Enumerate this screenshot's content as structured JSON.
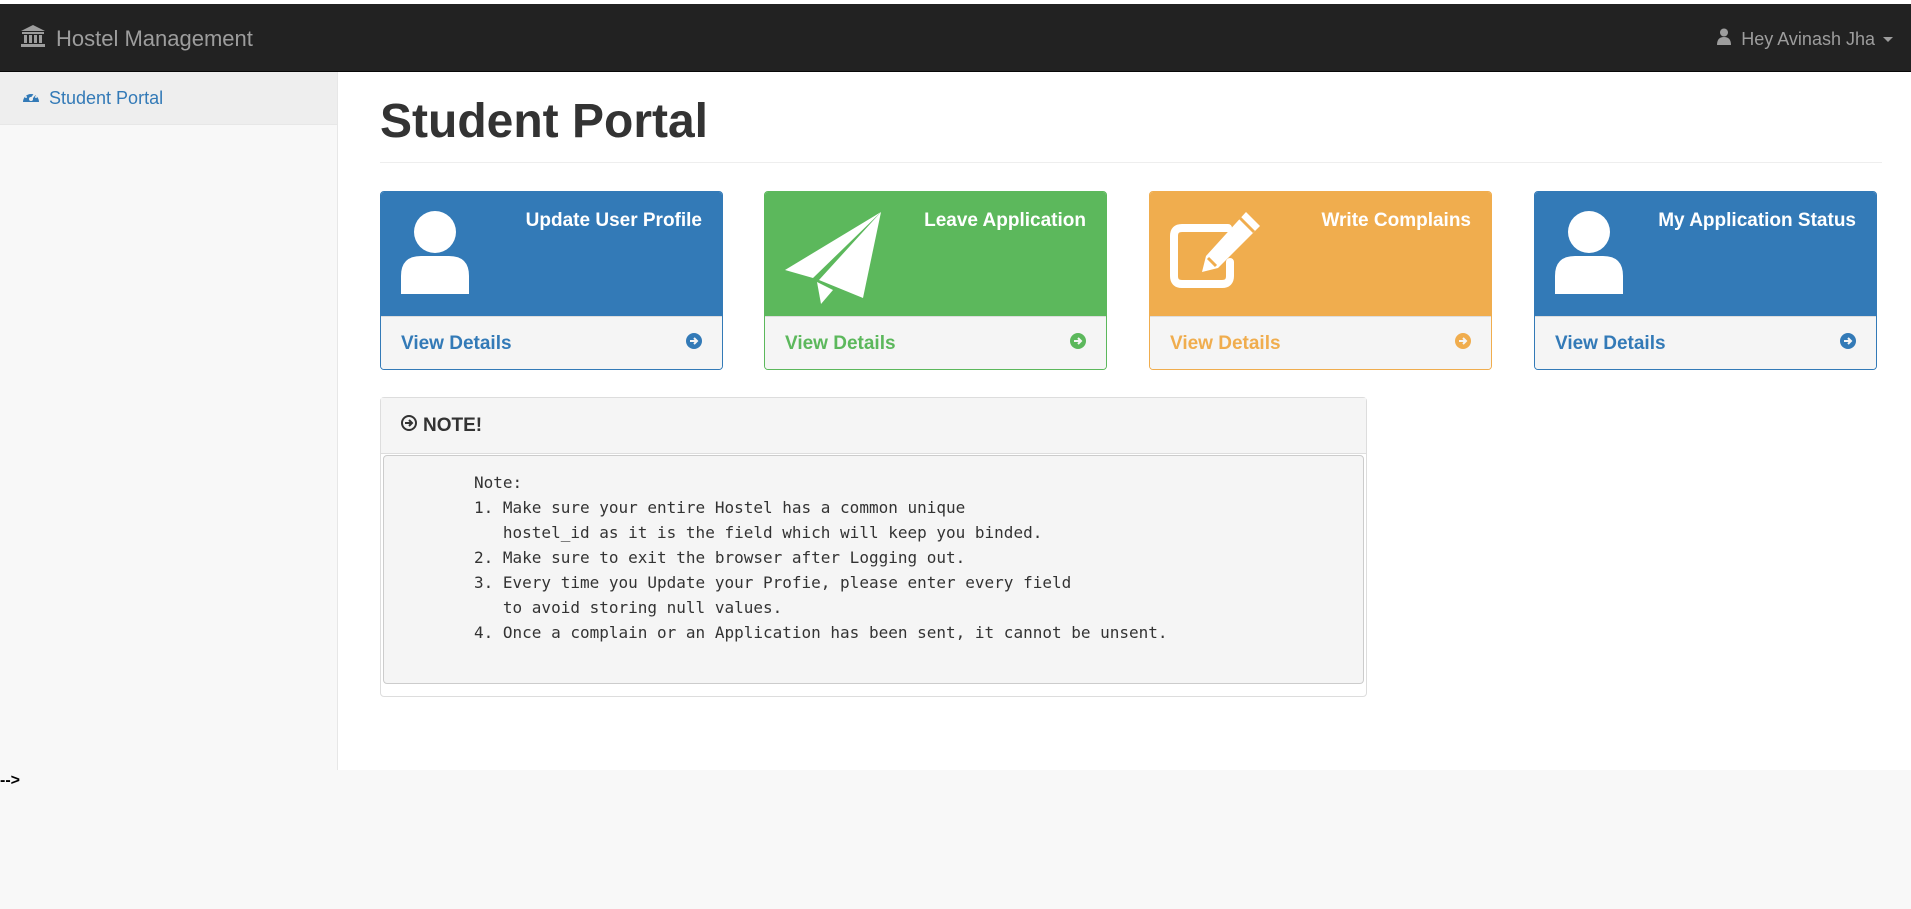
{
  "navbar": {
    "brand": "Hostel Management",
    "brand_icon": "institution-icon",
    "user_greeting": "Hey Avinash Jha"
  },
  "sidebar": {
    "items": [
      {
        "label": "Student Portal",
        "icon": "dashboard-icon"
      }
    ]
  },
  "main": {
    "title": "Student Portal",
    "cards": [
      {
        "title": "Update User Profile",
        "footer": "View Details",
        "color": "#337ab7",
        "icon": "user-icon"
      },
      {
        "title": "Leave Application",
        "footer": "View Details",
        "color": "#5cb85c",
        "icon": "paper-plane-icon"
      },
      {
        "title": "Write Complains",
        "footer": "View Details",
        "color": "#f0ad4e",
        "icon": "edit-icon"
      },
      {
        "title": "My Application Status",
        "footer": "View Details",
        "color": "#337ab7",
        "icon": "user-icon"
      }
    ],
    "note": {
      "heading": "NOTE!",
      "text": "Note:\n1. Make sure your entire Hostel has a common unique\n   hostel_id as it is the field which will keep you binded.\n2. Make sure to exit the browser after Logging out.\n3. Every time you Update your Profie, please enter every field\n   to avoid storing null values.\n4. Once a complain or an Application has been sent, it cannot be unsent."
    }
  },
  "stray_text": "-->"
}
